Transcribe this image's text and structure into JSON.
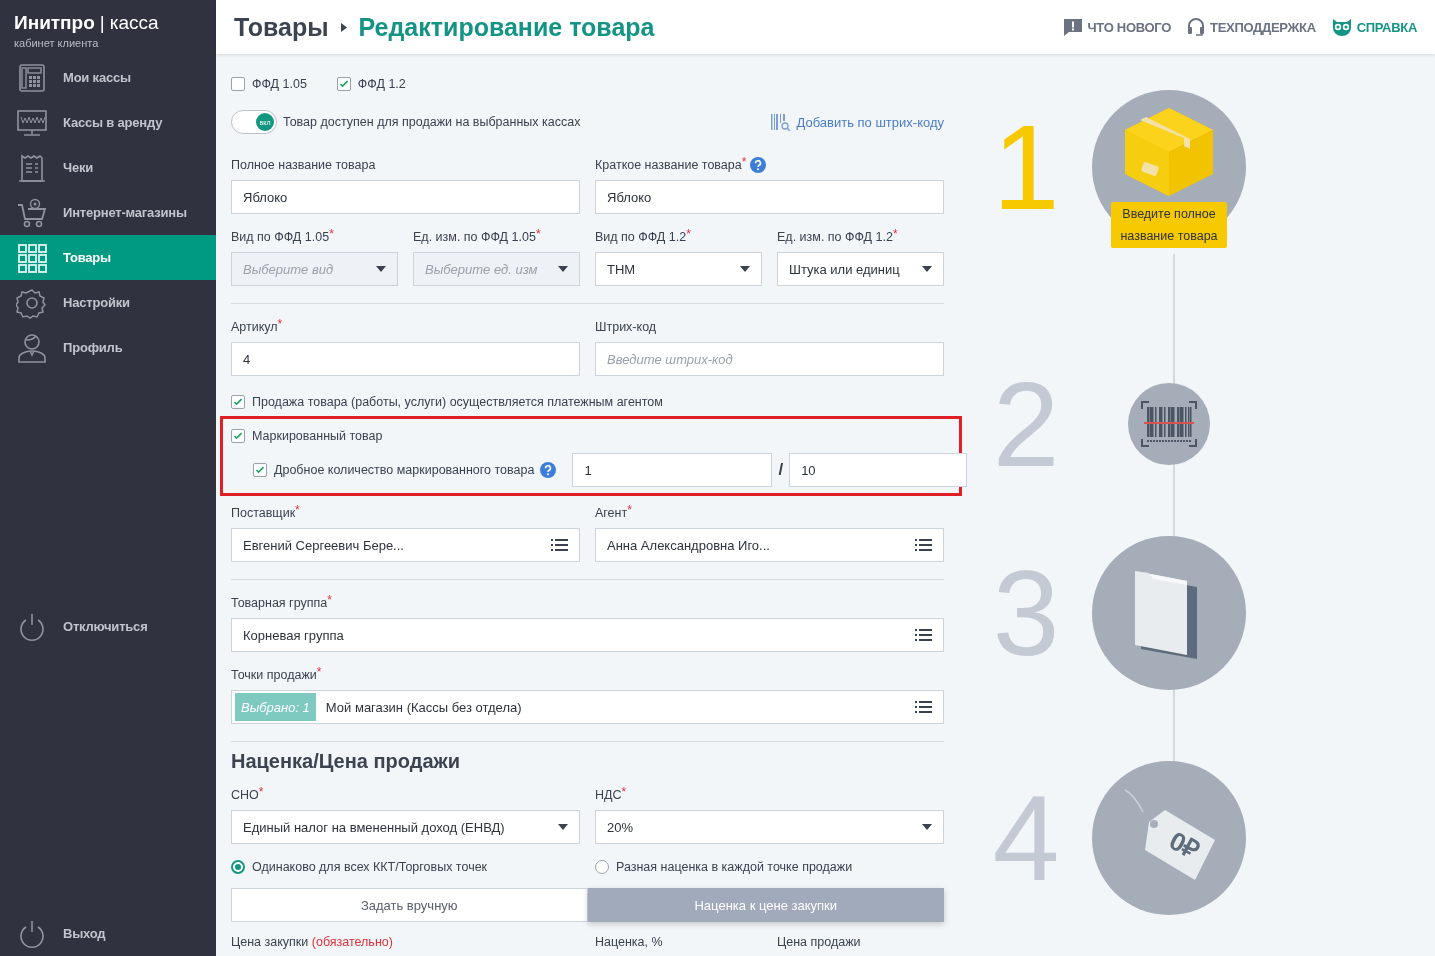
{
  "sidebar": {
    "brand": {
      "name": "Инитпро",
      "divider": "|",
      "product": "касса",
      "subtitle": "кабинет клиента"
    },
    "nav": [
      {
        "label": "Мои кассы",
        "kind": "register",
        "selected": false
      },
      {
        "label": "Кассы в аренду",
        "kind": "monitor",
        "selected": false
      },
      {
        "label": "Чеки",
        "kind": "receipt",
        "selected": false
      },
      {
        "label": "Интернет-магазины",
        "kind": "cart",
        "selected": false
      },
      {
        "label": "Товары",
        "kind": "grid",
        "selected": true
      },
      {
        "label": "Настройки",
        "kind": "gear",
        "selected": false
      },
      {
        "label": "Профиль",
        "kind": "person",
        "selected": false
      }
    ],
    "disconnect": "Отключиться",
    "logout": "Выход"
  },
  "header": {
    "breadcrumb": [
      "Товары",
      "Редактирование товара"
    ],
    "links": [
      {
        "label": "ЧТО НОВОГО",
        "kind": "alert",
        "color": "#6b7280"
      },
      {
        "label": "ТЕХПОДДЕРЖКА",
        "kind": "headset",
        "color": "#6b7280"
      },
      {
        "label": "СПРАВКА",
        "kind": "owl",
        "color": "#139484"
      }
    ]
  },
  "form": {
    "ffd_options": [
      {
        "label": "ФФД 1.05",
        "checked": false
      },
      {
        "label": "ФФД 1.2",
        "checked": true
      }
    ],
    "availability": {
      "badge": "вкл",
      "label": "Товар доступен для продажи на выбранных кассах",
      "on": true
    },
    "barcode_link": "Добавить по штрих-коду",
    "sections": [
      {
        "kind": "fields",
        "fields": [
          {
            "label": "Полное название товара",
            "kind": "input",
            "value": "Яблоко"
          },
          {
            "label": "Краткое название товара$^{*}$",
            "help": true,
            "kind": "input",
            "value": "Яблоко"
          }
        ]
      },
      {
        "kind": "fields",
        "fields": [
          {
            "label": "Вид по ФФД 1.05$^{*}$",
            "kind": "select",
            "placeholder": "Выберите вид",
            "disabled": true
          },
          {
            "label": "Ед. изм. по ФФД 1.05$^{*}$",
            "kind": "select",
            "placeholder": "Выберите ед. изм",
            "disabled": true
          },
          {
            "label": "Вид по ФФД 1.2$^{*}$",
            "kind": "select",
            "value": "ТНМ",
            "disabled": false
          },
          {
            "label": "Ед. изм. по ФФД 1.2$^{*}$",
            "kind": "select",
            "value": "Штука или единиц",
            "disabled": false
          }
        ]
      },
      {
        "kind": "divider"
      },
      {
        "kind": "fields",
        "fields": [
          {
            "label": "Артикул$^{*}$",
            "kind": "input",
            "value": "4"
          },
          {
            "label": "Штрих-код",
            "kind": "input",
            "placeholder": "Введите штрих-код"
          }
        ]
      },
      {
        "kind": "checkbox",
        "label": "Продажа товара (работы, услуги) осуществляется платежным агентом",
        "checked": true
      },
      {
        "kind": "marked_group",
        "highlighted": true,
        "checkbox": {
          "label": "Маркированный товар",
          "checked": true
        },
        "fraction": {
          "label": "Дробное количество маркированного товара",
          "checked": true,
          "help": true,
          "numerator": "1",
          "separator": "/",
          "denominator": "10"
        }
      },
      {
        "kind": "fields",
        "fields": [
          {
            "label": "Поставщик$^{*}$",
            "kind": "list",
            "value": "Евгений Сергеевич Бере..."
          },
          {
            "label": "Агент$^{*}$",
            "kind": "list",
            "value": "Анна Александровна Иго..."
          }
        ]
      },
      {
        "kind": "divider"
      },
      {
        "kind": "fields",
        "fields": [
          {
            "label": "Товарная группа$^{*}$",
            "kind": "list",
            "value": "Корневая группа"
          }
        ]
      },
      {
        "kind": "fields",
        "fields": [
          {
            "label": "Точки продажи$^{*}$",
            "kind": "list",
            "chip": "Выбрано: 1",
            "value": "Мой магазин (Кассы без отдела)"
          }
        ]
      },
      {
        "kind": "divider"
      },
      {
        "kind": "heading",
        "text": "Наценка/Цена продажи"
      },
      {
        "kind": "fields",
        "fields": [
          {
            "label": "СНО$^{*}$",
            "kind": "select",
            "value": "Единый налог на вмененный доход (ЕНВД)",
            "disabled": false
          },
          {
            "label": "НДС$^{*}$",
            "kind": "select",
            "value": "20%",
            "disabled": false
          }
        ]
      },
      {
        "kind": "radios",
        "options": [
          {
            "label": "Одинаково для всех ККТ/Торговых точек",
            "selected": true
          },
          {
            "label": "Разная наценка в каждой точке продажи",
            "selected": false
          }
        ]
      },
      {
        "kind": "segmented",
        "options": [
          {
            "label": "Задать вручную",
            "selected": false
          },
          {
            "label": "Наценка к цене закупки",
            "selected": true
          }
        ]
      },
      {
        "kind": "labels",
        "items": [
          {
            "text": "Цена закупки",
            "note": "(обязательно)"
          },
          {
            "text": "Наценка, %"
          },
          {
            "text": "Цена продажи"
          }
        ]
      }
    ]
  },
  "steps": [
    {
      "number": "1",
      "active": true,
      "kind": "box",
      "tooltip": "Введите полное название товара"
    },
    {
      "number": "2",
      "active": false,
      "kind": "barcode"
    },
    {
      "number": "3",
      "active": false,
      "kind": "folder"
    },
    {
      "number": "4",
      "active": false,
      "kind": "tag",
      "tag_text": "0₽"
    }
  ]
}
